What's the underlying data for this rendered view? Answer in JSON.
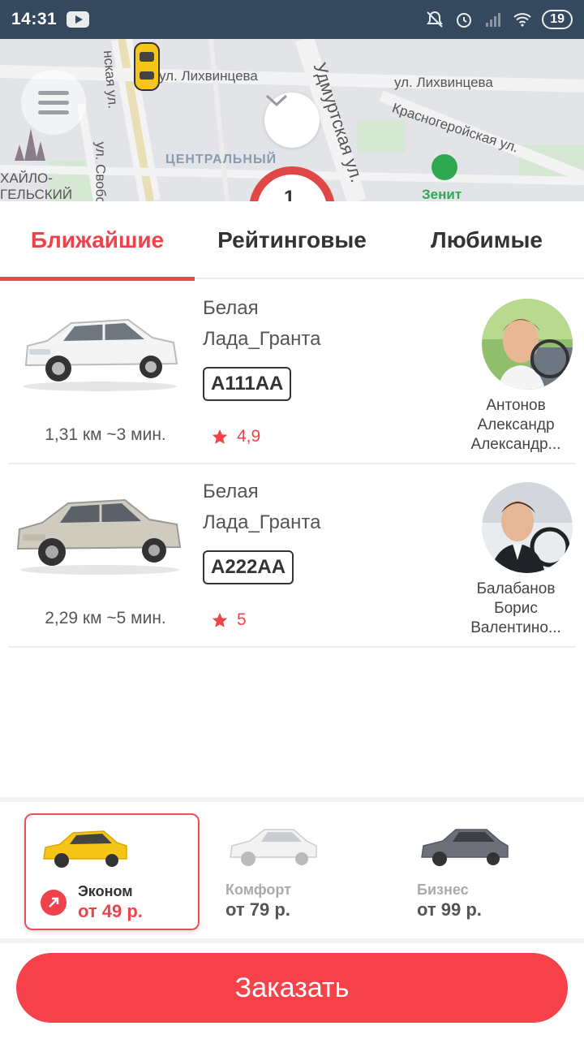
{
  "status_bar": {
    "time": "14:31",
    "battery": "19"
  },
  "map": {
    "streets": [
      "ул. Лихвинцева",
      "ул. Лихвинцева",
      "Удмуртская ул.",
      "Красногеройская ул.",
      "Центральный",
      "ул. Свобод",
      "нская ул.",
      "ХАЙЛО-",
      "ГЕЛЬСКИЙ",
      "Зенит"
    ],
    "marker_number": "1"
  },
  "tabs": [
    {
      "label": "Ближайшие",
      "active": true
    },
    {
      "label": "Рейтинговые",
      "active": false
    },
    {
      "label": "Любимые",
      "active": false
    }
  ],
  "cars": [
    {
      "color": "Белая",
      "model": "Лада_Гранта",
      "plate": "А111АА",
      "eta": "1,31 км ~3 мин.",
      "rating": "4,9",
      "driver_lines": [
        "Антонов",
        "Александр",
        "Александр..."
      ]
    },
    {
      "color": "Белая",
      "model": "Лада_Гранта",
      "plate": "А222АА",
      "eta": "2,29 км ~5 мин.",
      "rating": "5",
      "driver_lines": [
        "Балабанов",
        "Борис",
        "Валентино..."
      ]
    }
  ],
  "tariffs": [
    {
      "name": "Эконом",
      "price": "от 49 р.",
      "active": true
    },
    {
      "name": "Комфорт",
      "price": "от 79 р.",
      "active": false
    },
    {
      "name": "Бизнес",
      "price": "от 99 р.",
      "active": false
    }
  ],
  "order_button": "Заказать",
  "colors": {
    "accent": "#f0424b",
    "status_bar": "#34495e",
    "taxi_yellow": "#f5c518"
  }
}
